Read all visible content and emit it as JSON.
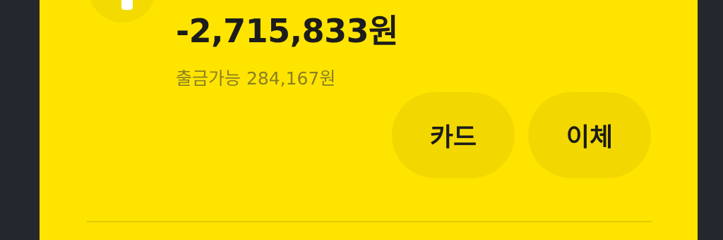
{
  "account": {
    "balance": "-2,715,833원",
    "available_label": "출금가능 284,167원"
  },
  "actions": {
    "card_label": "카드",
    "transfer_label": "이체"
  },
  "colors": {
    "background": "#24272d",
    "card": "#ffe400",
    "button": "#f2d800",
    "text": "#1c1c1c",
    "subtext": "#8a7f22"
  }
}
